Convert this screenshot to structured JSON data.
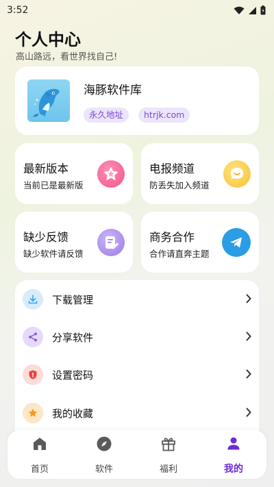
{
  "status_bar": {
    "time": "3:52"
  },
  "header": {
    "title": "个人中心",
    "subtitle": "高山路远，看世界找自己!"
  },
  "profile": {
    "name": "海豚软件库",
    "tags": [
      "永久地址",
      "htrjk.com"
    ]
  },
  "grid": [
    {
      "title": "最新版本",
      "subtitle": "当前已是最新版",
      "icon": "star-icon",
      "color": "#f2548a"
    },
    {
      "title": "电报频道",
      "subtitle": "防丢失加入频道",
      "icon": "chat-smile-icon",
      "color": "#f5c53a"
    },
    {
      "title": "缺少反馈",
      "subtitle": "缺少软件请反馈",
      "icon": "feedback-icon",
      "color": "#9b7ae6"
    },
    {
      "title": "商务合作",
      "subtitle": "合作请直奔主题",
      "icon": "telegram-icon",
      "color": "#2a9de4"
    }
  ],
  "menu": [
    {
      "label": "下载管理",
      "icon": "download-icon",
      "color": "#3aa5e8"
    },
    {
      "label": "分享软件",
      "icon": "share-icon",
      "color": "#8a5ad8"
    },
    {
      "label": "设置密码",
      "icon": "shield-icon",
      "color": "#e6463c"
    },
    {
      "label": "我的收藏",
      "icon": "star-icon",
      "color": "#f29a1c"
    }
  ],
  "nav": [
    {
      "label": "首页",
      "icon": "home-icon"
    },
    {
      "label": "软件",
      "icon": "compass-icon"
    },
    {
      "label": "福利",
      "icon": "gift-icon"
    },
    {
      "label": "我的",
      "icon": "user-icon",
      "active": true
    }
  ],
  "colors": {
    "accent": "#6c2bd9",
    "tag_bg": "#ece5fb",
    "tag_text": "#7a4ad4"
  }
}
